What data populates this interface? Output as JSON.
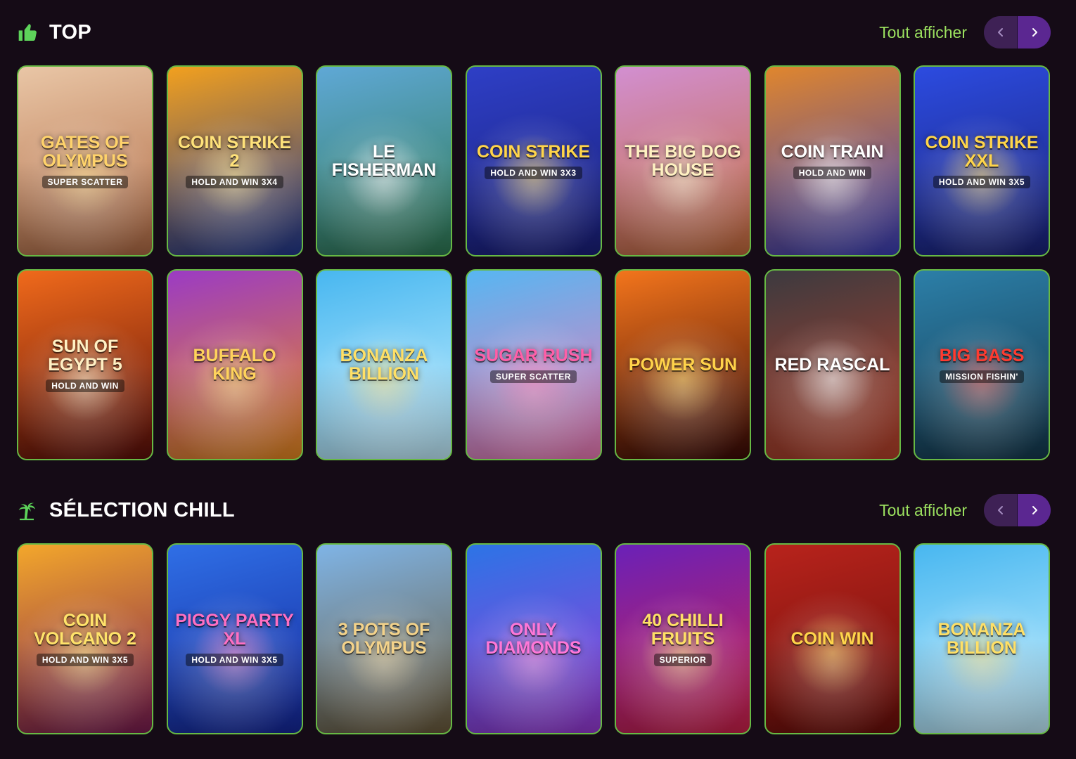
{
  "sections": [
    {
      "title": "TOP",
      "icon": "thumbs-up-icon",
      "view_all": "Tout afficher",
      "games": [
        {
          "title": "Gates of Olympus",
          "subtitle": "Super Scatter",
          "colors": [
            "#e9c6a6",
            "#b06a44"
          ],
          "text_color": "#ffd36b"
        },
        {
          "title": "Coin Strike 2",
          "subtitle": "Hold and Win 3x4",
          "colors": [
            "#f2a01e",
            "#20388f"
          ],
          "text_color": "#ffe27a"
        },
        {
          "title": "Le Fisherman",
          "subtitle": "",
          "colors": [
            "#5fa8d6",
            "#2f7a54"
          ],
          "text_color": "#ffffff"
        },
        {
          "title": "Coin Strike",
          "subtitle": "Hold and Win 3x3",
          "colors": [
            "#2e3fc6",
            "#1a1f7a"
          ],
          "text_color": "#ffd54a"
        },
        {
          "title": "The Big Dog House",
          "subtitle": "",
          "colors": [
            "#d28fd1",
            "#c36a3a"
          ],
          "text_color": "#fff1c2"
        },
        {
          "title": "Coin Train",
          "subtitle": "Hold and Win",
          "colors": [
            "#e0862d",
            "#3a3fb8"
          ],
          "text_color": "#ffffff"
        },
        {
          "title": "Coin Strike XXL",
          "subtitle": "Hold and Win 3x5",
          "colors": [
            "#2c4be0",
            "#1b2378"
          ],
          "text_color": "#ffd54a"
        },
        {
          "title": "Sun of Egypt 5",
          "subtitle": "Hold and Win",
          "colors": [
            "#f06a1b",
            "#5c0f0a"
          ],
          "text_color": "#fff0c4"
        },
        {
          "title": "Buffalo King",
          "subtitle": "",
          "colors": [
            "#9b3bc4",
            "#e88a20"
          ],
          "text_color": "#ffd35c"
        },
        {
          "title": "Bonanza Billion",
          "subtitle": "",
          "colors": [
            "#48b7f0",
            "#c7f0ff"
          ],
          "text_color": "#ffe066"
        },
        {
          "title": "Sugar Rush",
          "subtitle": "Super Scatter",
          "colors": [
            "#57b6f2",
            "#f07ab5"
          ],
          "text_color": "#ff5fa8"
        },
        {
          "title": "Power Sun",
          "subtitle": "",
          "colors": [
            "#f3751c",
            "#3a0a06"
          ],
          "text_color": "#ffd34a"
        },
        {
          "title": "Red Rascal",
          "subtitle": "",
          "colors": [
            "#3c3a3f",
            "#b8412a"
          ],
          "text_color": "#ffffff"
        },
        {
          "title": "Big Bass",
          "subtitle": "Mission Fishin'",
          "colors": [
            "#2c7fa8",
            "#15394e"
          ],
          "text_color": "#ff3b30"
        }
      ]
    },
    {
      "title": "SÉLECTION CHILL",
      "icon": "palm-tree-icon",
      "view_all": "Tout afficher",
      "games": [
        {
          "title": "Coin Volcano 2",
          "subtitle": "Hold and Win 3x5",
          "colors": [
            "#f3a72b",
            "#7a1c52"
          ],
          "text_color": "#ffe36a"
        },
        {
          "title": "Piggy Party XL",
          "subtitle": "Hold and Win 3x5",
          "colors": [
            "#2f6fe6",
            "#15279a"
          ],
          "text_color": "#ff6fc2"
        },
        {
          "title": "3 Pots of Olympus",
          "subtitle": "",
          "colors": [
            "#7fb4e6",
            "#6b5a3a"
          ],
          "text_color": "#f3d28a"
        },
        {
          "title": "Only Diamonds",
          "subtitle": "",
          "colors": [
            "#2c74e6",
            "#9a3ad6"
          ],
          "text_color": "#ff77d8"
        },
        {
          "title": "40 Chilli Fruits",
          "subtitle": "Superior",
          "colors": [
            "#6a21b8",
            "#d0224a"
          ],
          "text_color": "#ffe066"
        },
        {
          "title": "Coin Win",
          "subtitle": "",
          "colors": [
            "#b8231c",
            "#6a0f0a"
          ],
          "text_color": "#ffd54a"
        },
        {
          "title": "Bonanza Billion",
          "subtitle": "",
          "colors": [
            "#48b7f0",
            "#c7f0ff"
          ],
          "text_color": "#ffe066"
        }
      ]
    }
  ]
}
